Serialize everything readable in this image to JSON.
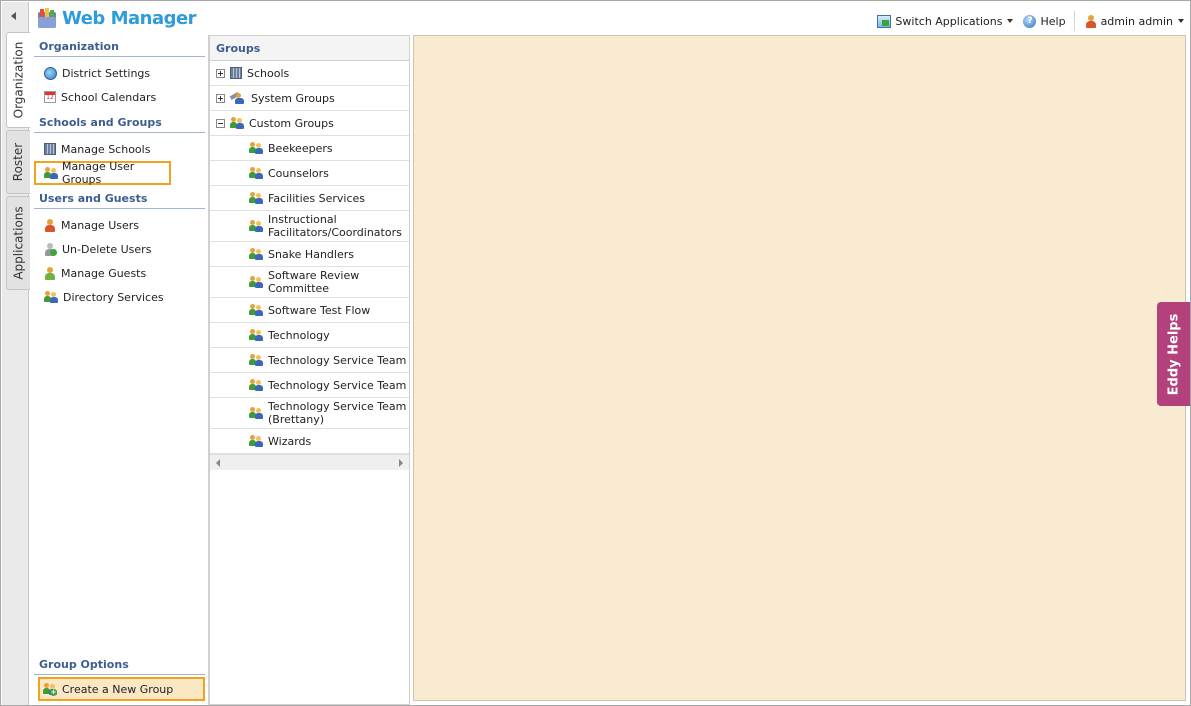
{
  "window": {
    "title": "Web Manager"
  },
  "vertical_tabs": [
    {
      "label": "Organization",
      "active": true
    },
    {
      "label": "Roster",
      "active": false
    },
    {
      "label": "Applications",
      "active": false
    }
  ],
  "header": {
    "logo_text": "Web Manager",
    "switch_applications": "Switch Applications",
    "help": "Help",
    "user": "admin admin"
  },
  "nav": {
    "organization": {
      "heading": "Organization",
      "items": [
        {
          "label": "District Settings",
          "icon": "globe-icon"
        },
        {
          "label": "School Calendars",
          "icon": "calendar-icon"
        }
      ]
    },
    "schools_groups": {
      "heading": "Schools and Groups",
      "items": [
        {
          "label": "Manage Schools",
          "icon": "building-icon"
        },
        {
          "label": "Manage User Groups",
          "icon": "users-icon"
        }
      ]
    },
    "users_guests": {
      "heading": "Users and Guests",
      "items": [
        {
          "label": "Manage Users",
          "icon": "user-icon"
        },
        {
          "label": "Un-Delete Users",
          "icon": "undelete-user-icon"
        },
        {
          "label": "Manage Guests",
          "icon": "guest-icon"
        },
        {
          "label": "Directory Services",
          "icon": "users-icon"
        }
      ]
    },
    "group_options": {
      "heading": "Group Options",
      "items": [
        {
          "label": "Create a New Group",
          "icon": "add-group-icon"
        }
      ]
    }
  },
  "groups": {
    "heading": "Groups",
    "top": [
      {
        "label": "Schools",
        "expander": "plus"
      },
      {
        "label": "System Groups",
        "expander": "plus"
      },
      {
        "label": "Custom Groups",
        "expander": "minus"
      }
    ],
    "custom": [
      "Beekeepers",
      "Counselors",
      "Facilities Services",
      "Instructional Facilitators/Coordinators",
      "Snake Handlers",
      "Software Review Committee",
      "Software Test Flow",
      "Technology",
      "Technology Service Team",
      "Technology Service Team",
      "Technology Service Team (Brettany)",
      "Wizards"
    ]
  },
  "eddy_helps": "Eddy Helps",
  "colors": {
    "accent_highlight": "#f2a31e",
    "heading_blue": "#3c5e8f",
    "content_bg": "#f8ebd2",
    "eddy_bg": "#b3427c",
    "logo_blue": "#2f9bd8"
  }
}
